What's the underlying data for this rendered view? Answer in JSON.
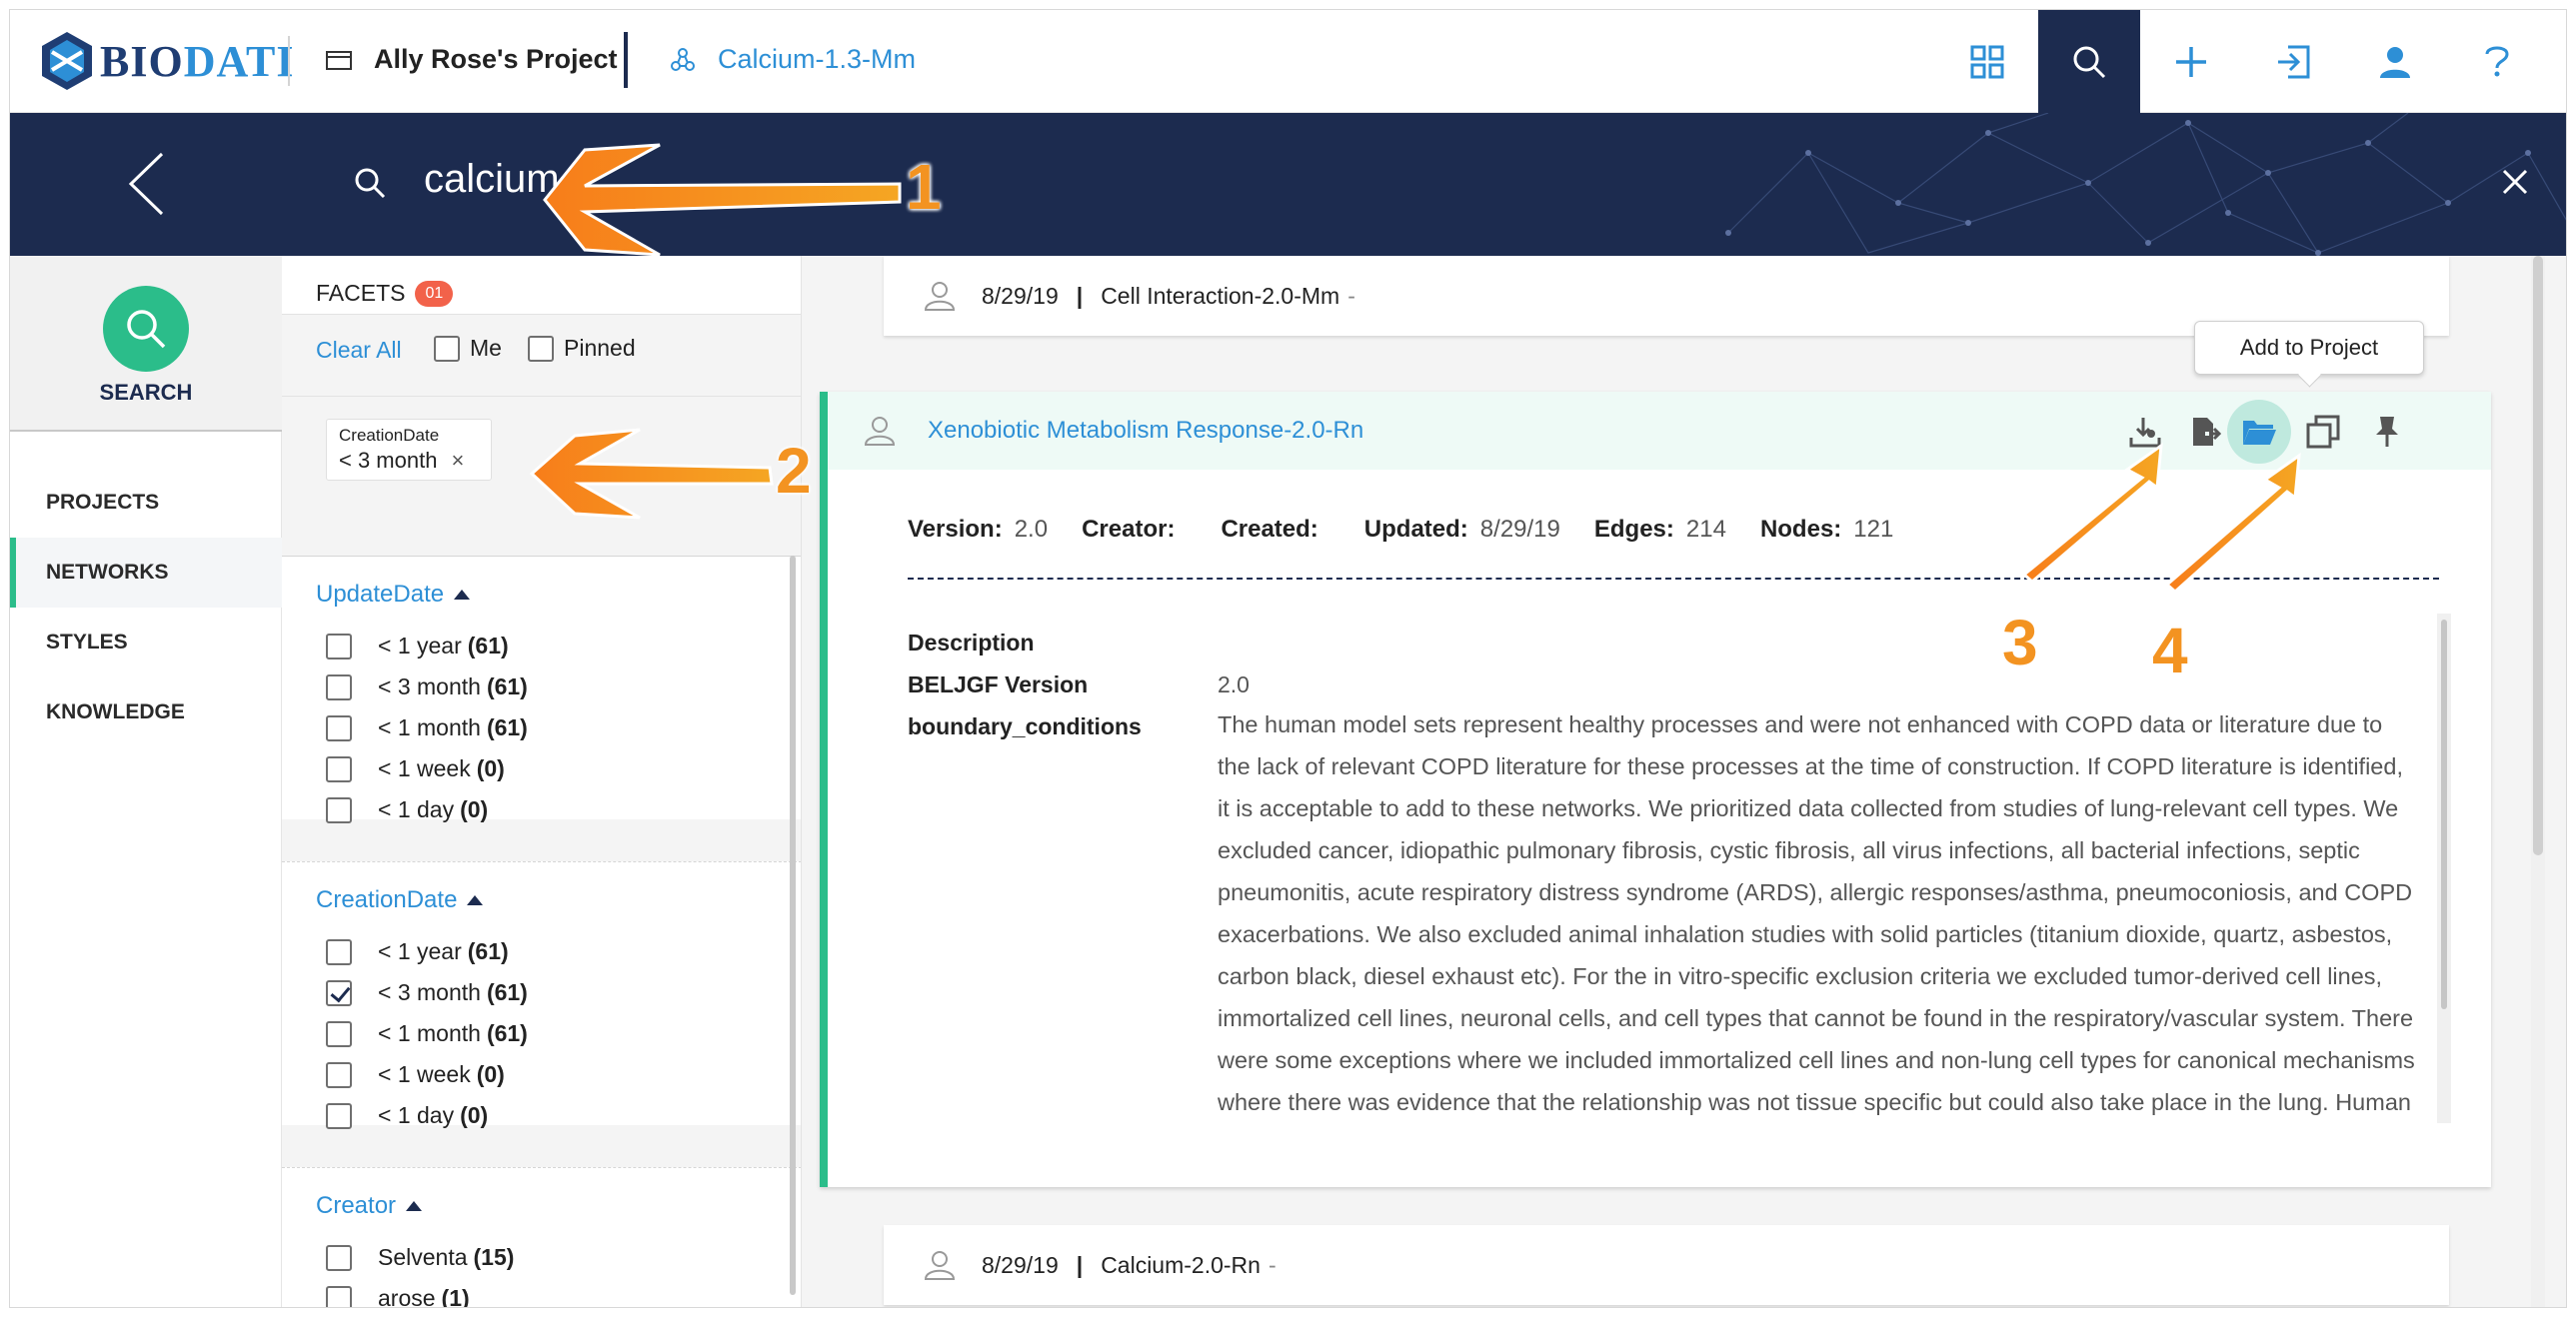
{
  "header": {
    "logo_text_a": "BIO",
    "logo_text_b": "DATI",
    "project_name": "Ally Rose's Project",
    "network_name": "Calcium-1.3-Mm",
    "icons": [
      "grid-icon",
      "search-icon",
      "plus-icon",
      "import-icon",
      "user-icon",
      "help-icon"
    ]
  },
  "search": {
    "query": "calcium"
  },
  "nav": {
    "search_label": "SEARCH",
    "items": [
      "PROJECTS",
      "NETWORKS",
      "STYLES",
      "KNOWLEDGE"
    ],
    "active": "NETWORKS"
  },
  "facets": {
    "title": "FACETS",
    "badge": "01",
    "clear_all": "Clear All",
    "me_label": "Me",
    "pinned_label": "Pinned",
    "active_filter": {
      "label": "CreationDate",
      "value": "< 3 month",
      "remove": "×"
    },
    "groups": [
      {
        "title": "UpdateDate",
        "options": [
          {
            "label": "< 1 year",
            "count": "(61)",
            "checked": false
          },
          {
            "label": "< 3 month",
            "count": "(61)",
            "checked": false
          },
          {
            "label": "< 1 month",
            "count": "(61)",
            "checked": false
          },
          {
            "label": "< 1 week",
            "count": "(0)",
            "checked": false
          },
          {
            "label": "< 1 day",
            "count": "(0)",
            "checked": false
          }
        ]
      },
      {
        "title": "CreationDate",
        "options": [
          {
            "label": "< 1 year",
            "count": "(61)",
            "checked": false
          },
          {
            "label": "< 3 month",
            "count": "(61)",
            "checked": true
          },
          {
            "label": "< 1 month",
            "count": "(61)",
            "checked": false
          },
          {
            "label": "< 1 week",
            "count": "(0)",
            "checked": false
          },
          {
            "label": "< 1 day",
            "count": "(0)",
            "checked": false
          }
        ]
      },
      {
        "title": "Creator",
        "options": [
          {
            "label": "Selventa",
            "count": "(15)",
            "checked": false
          },
          {
            "label": "arose",
            "count": "(1)",
            "checked": false
          }
        ]
      }
    ]
  },
  "results": {
    "row_top": {
      "date": "8/29/19",
      "sep": "|",
      "name": "Cell Interaction-2.0-Mm",
      "dash": "-"
    },
    "row_bottom": {
      "date": "8/29/19",
      "sep": "|",
      "name": "Calcium-2.0-Rn",
      "dash": "-"
    },
    "card": {
      "title": "Xenobiotic Metabolism Response-2.0-Rn",
      "tooltip": "Add to Project",
      "meta": {
        "version_k": "Version:",
        "version_v": "2.0",
        "creator_k": "Creator:",
        "creator_v": "",
        "created_k": "Created:",
        "created_v": "",
        "updated_k": "Updated:",
        "updated_v": "8/29/19",
        "edges_k": "Edges:",
        "edges_v": "214",
        "nodes_k": "Nodes:",
        "nodes_v": "121"
      },
      "props": {
        "description_k": "Description",
        "beljgf_k": "BELJGF Version",
        "beljgf_v": "2.0",
        "boundary_k": "boundary_conditions",
        "boundary_v": "The human model sets represent healthy processes and were not enhanced with COPD data or literature due to the lack of relevant COPD literature for these processes at the time of construction. If COPD literature is identified, it is acceptable to add to these networks. We prioritized data collected from studies of lung-relevant cell types. We excluded cancer, idiopathic pulmonary fibrosis, cystic fibrosis, all virus infections, all bacterial infections, septic pneumonitis, acute respiratory distress syndrome (ARDS), allergic responses/asthma, pneumoconiosis, and COPD exacerbations. We also excluded animal inhalation studies with solid particles (titanium dioxide, quartz, asbestos, carbon black, diesel exhaust etc). For the in vitro-specific exclusion criteria we excluded tumor-derived cell lines, immortalized cell lines, neuronal cells, and cell types that cannot be found in the respiratory/vascular system. There were some exceptions where we included immortalized cell lines and non-lung cell types for canonical mechanisms where there was evidence that the relationship was not tissue specific but could also take place in the lung. Human specific"
      }
    }
  },
  "annotations": [
    "1",
    "2",
    "3",
    "4"
  ],
  "colors": {
    "navy": "#1c2b4f",
    "accent_green": "#2bbd8a",
    "link_blue": "#2d8fd6",
    "annotation_orange": "#f39321"
  }
}
